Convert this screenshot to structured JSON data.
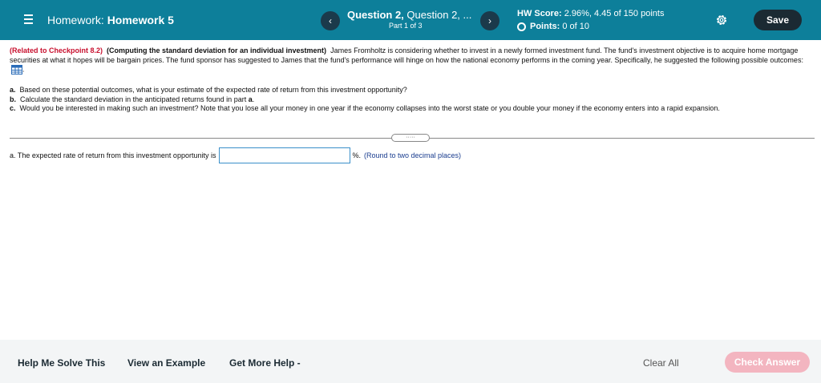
{
  "header": {
    "menu_icon": "hamburger-icon",
    "hw_label": "Homework:",
    "hw_name": "Homework 5",
    "prev_label": "‹",
    "next_label": "›",
    "question_bold": "Question 2,",
    "question_rest": "Question 2, ...",
    "part": "Part 1 of 3",
    "score_label": "HW Score:",
    "score_value": "2.96%, 4.45 of 150 points",
    "points_label": "Points:",
    "points_value": "0 of 10",
    "settings_icon": "gear-icon",
    "save_label": "Save",
    "bar_color": "#0d7f9a"
  },
  "problem": {
    "related": "(Related to Checkpoint 8.2)",
    "title": "(Computing the standard deviation for an individual investment)",
    "text": "James Fromholtz is considering whether to invest in a newly formed investment fund.  The fund's investment objective is to acquire home mortgage securities at what it hopes will be bargain prices.  The fund sponsor has suggested to James that the fund's performance will hinge on how the national economy performs in the coming year.  Specifically, he suggested the following possible outcomes:",
    "table_icon": "table-icon",
    "after_icon": ".",
    "parts": [
      {
        "label": "a.",
        "text": "Based on these potential outcomes, what is your estimate of the expected rate of return from this investment opportunity?"
      },
      {
        "label": "b.",
        "text": "Calculate the standard deviation in the anticipated returns found in part",
        "tail": "a",
        "end": "."
      },
      {
        "label": "c.",
        "text": "Would you be interested in making such an investment?  Note that you lose all your money in one year if the economy collapses into the worst state or you double your money if the economy enters into a rapid expansion."
      }
    ]
  },
  "answer": {
    "expand_label": "·····",
    "prefix": "a.  The expected rate of return from this investment opportunity is",
    "value": "",
    "suffix": "%.",
    "hint": "(Round to two decimal places)"
  },
  "footer": {
    "help_solve": "Help Me Solve This",
    "view_example": "View an Example",
    "more_help": "Get More Help -",
    "clear_all": "Clear All",
    "check_answer": "Check Answer",
    "check_color": "#f3b5c0"
  }
}
